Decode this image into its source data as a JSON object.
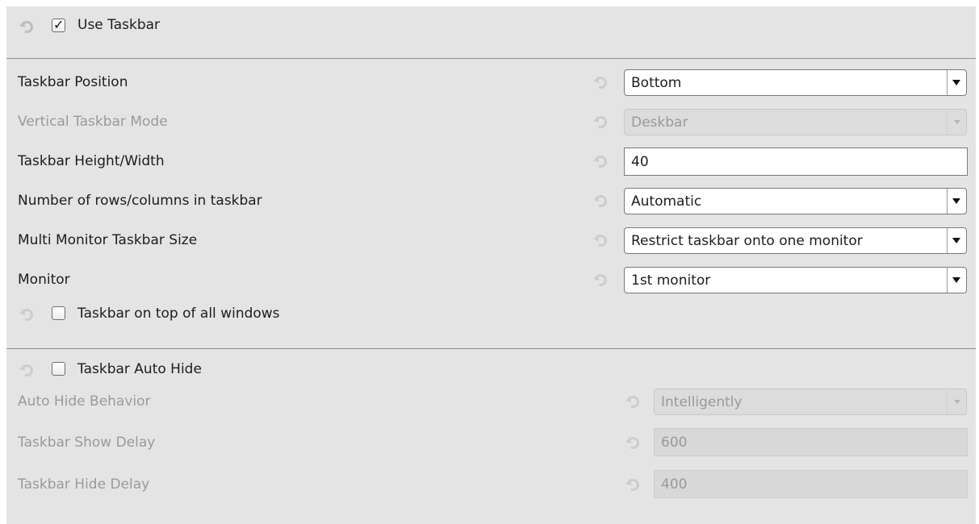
{
  "use_taskbar": {
    "label": "Use Taskbar",
    "checked": true
  },
  "taskbar_position": {
    "label": "Taskbar Position",
    "value": "Bottom"
  },
  "vertical_taskbar_mode": {
    "label": "Vertical Taskbar Mode",
    "value": "Deskbar",
    "enabled": false
  },
  "taskbar_height": {
    "label": "Taskbar Height/Width",
    "value": "40"
  },
  "rows_columns": {
    "label": "Number of rows/columns in taskbar",
    "value": "Automatic"
  },
  "multi_monitor_size": {
    "label": "Multi Monitor Taskbar Size",
    "value": "Restrict taskbar onto one monitor"
  },
  "monitor": {
    "label": "Monitor",
    "value": "1st monitor"
  },
  "on_top": {
    "label": "Taskbar on top of all windows",
    "checked": false
  },
  "auto_hide": {
    "label": "Taskbar Auto Hide",
    "checked": false
  },
  "auto_hide_behavior": {
    "label": "Auto Hide Behavior",
    "value": "Intelligently",
    "enabled": false
  },
  "show_delay": {
    "label": "Taskbar Show Delay",
    "value": "600",
    "enabled": false
  },
  "hide_delay": {
    "label": "Taskbar Hide Delay",
    "value": "400",
    "enabled": false
  },
  "icons": {
    "reset": "reset-default-icon",
    "dropdown": "dropdown-arrow-icon"
  }
}
